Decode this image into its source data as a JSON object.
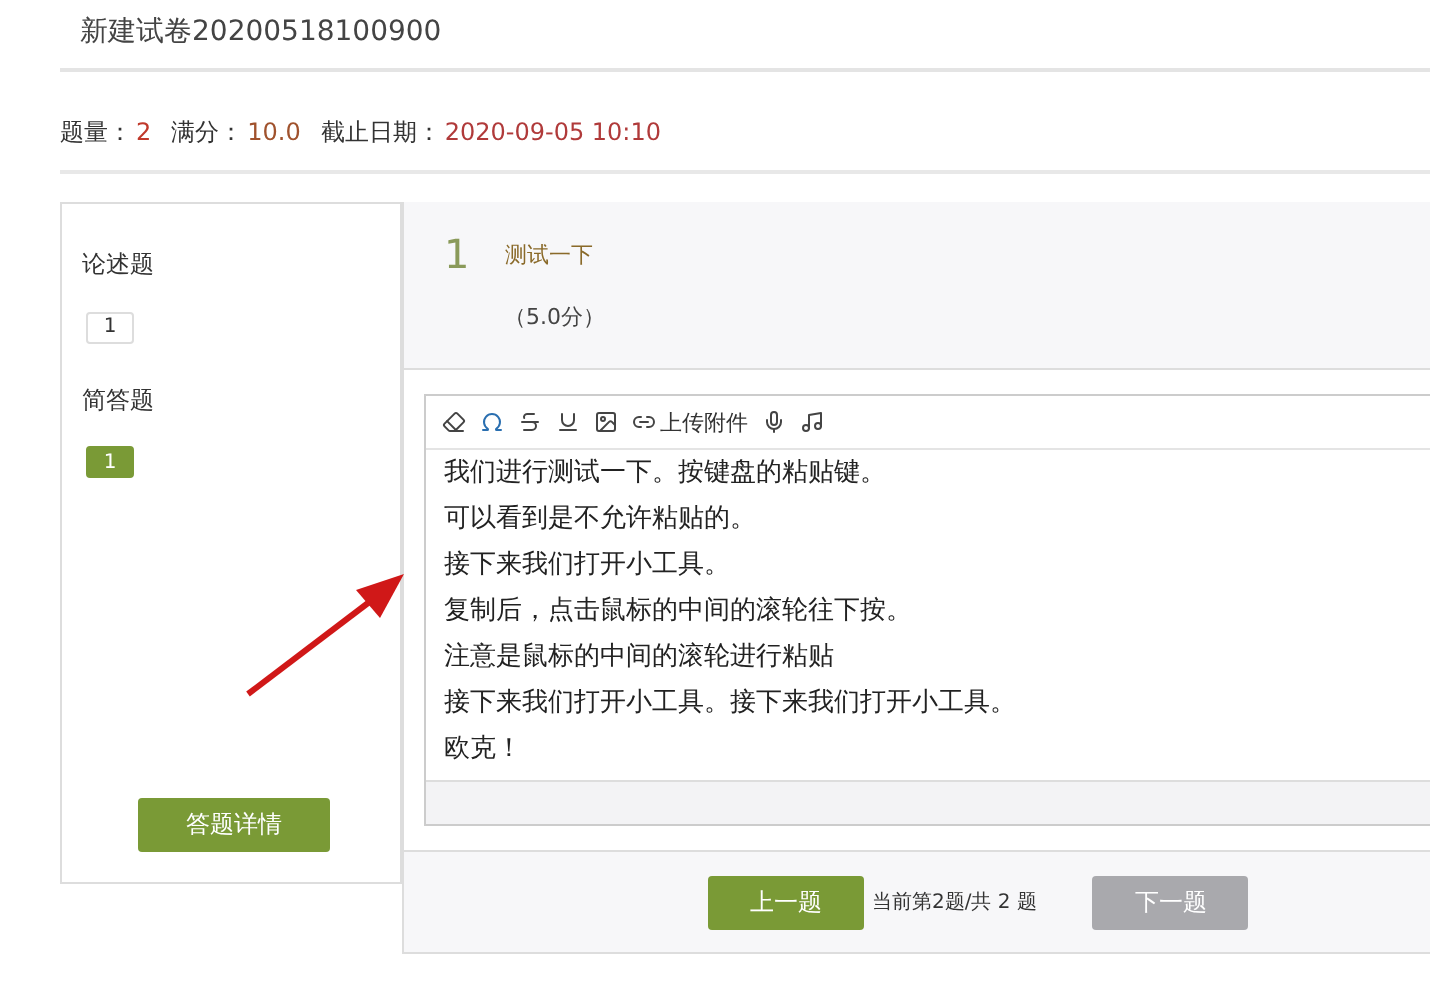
{
  "title": "新建试卷20200518100900",
  "stats": [
    {
      "label": "题量：",
      "value": "2"
    },
    {
      "label": "满分：",
      "value": "10.0"
    },
    {
      "label": "截止日期：",
      "value": "2020-09-05 10:10"
    }
  ],
  "sidebar": {
    "groups": [
      {
        "title": "论述题",
        "questions": [
          {
            "label": "1",
            "answered": false
          }
        ]
      },
      {
        "title": "简答题",
        "questions": [
          {
            "label": "1",
            "answered": true
          }
        ]
      }
    ],
    "details_button": "答题详情"
  },
  "question": {
    "number": "1",
    "text": "测试一下",
    "score": "（5.0分）"
  },
  "editor": {
    "toolbar": [
      {
        "kind": "eraser"
      },
      {
        "kind": "omega"
      },
      {
        "kind": "strike"
      },
      {
        "kind": "underline"
      },
      {
        "kind": "image"
      },
      {
        "kind": "attach",
        "label": "上传附件"
      },
      {
        "kind": "mic"
      },
      {
        "kind": "music"
      }
    ],
    "lines": [
      "我们进行测试一下。按键盘的粘贴键。",
      "可以看到是不允许粘贴的。",
      "接下来我们打开小工具。",
      "复制后，点击鼠标的中间的滚轮往下按。",
      "注意是鼠标的中间的滚轮进行粘贴",
      "接下来我们打开小工具。接下来我们打开小工具。",
      "欧克！"
    ]
  },
  "footer": {
    "prev": {
      "label": "上一题",
      "disabled": false
    },
    "position": "当前第2题/共 2 题",
    "next": {
      "label": "下一题",
      "disabled": true
    }
  }
}
